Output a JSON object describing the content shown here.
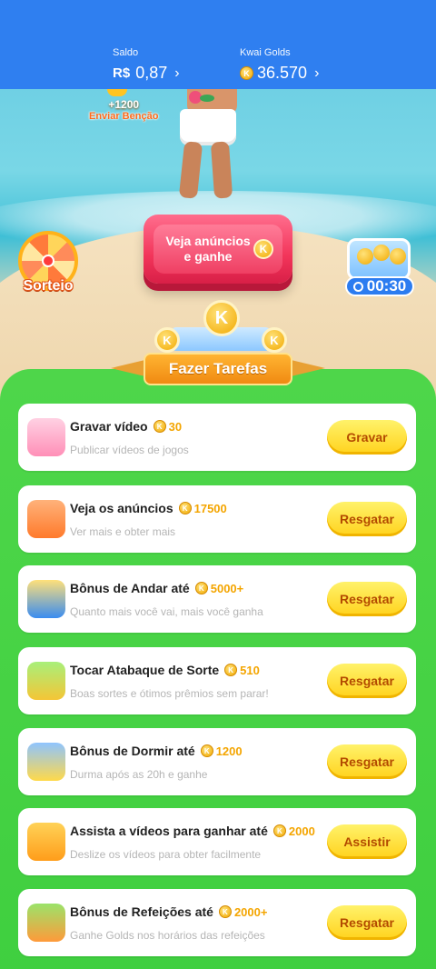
{
  "balance": {
    "saldo_label": "Saldo",
    "currency": "R$",
    "saldo_value": "0,87",
    "golds_label": "Kwai Golds",
    "golds_value": "36.570",
    "chevron": "›"
  },
  "scene": {
    "bencao_amount": "+1200",
    "bencao_label": "Enviar Benção",
    "ad_button_label": "Veja anúncios e ganhe",
    "sorteio_label": "Sorteio",
    "timer_value": "00:30",
    "coin_letter": "K"
  },
  "tasks_header": "Fazer Tarefas",
  "tasks": [
    {
      "title": "Gravar vídeo",
      "reward": "30",
      "subtitle": "Publicar vídeos de jogos",
      "button": "Gravar",
      "icon": "record-video-icon"
    },
    {
      "title": "Veja os anúncios",
      "reward": "17500",
      "subtitle": "Ver mais e obter mais",
      "button": "Resgatar",
      "icon": "tv-ad-icon"
    },
    {
      "title": "Bônus de Andar até",
      "reward": "5000+",
      "subtitle": "Quanto mais você vai, mais você ganha",
      "button": "Resgatar",
      "icon": "walking-boy-icon"
    },
    {
      "title": "Tocar Atabaque de Sorte",
      "reward": "510",
      "subtitle": "Boas sortes e ótimos prêmios sem parar!",
      "button": "Resgatar",
      "icon": "drum-icon"
    },
    {
      "title": "Bônus de Dormir até",
      "reward": "1200",
      "subtitle": "Durma após as 20h e ganhe",
      "button": "Resgatar",
      "icon": "moon-sleep-icon"
    },
    {
      "title": "Assista a vídeos para ganhar até",
      "reward": "2000",
      "subtitle": "Deslize os vídeos para obter facilmente",
      "button": "Assistir",
      "icon": "video-camera-icon"
    },
    {
      "title": "Bônus de Refeições até",
      "reward": "2000+",
      "subtitle": "Ganhe Golds nos horários das refeições",
      "button": "Resgatar",
      "icon": "meal-box-icon"
    }
  ],
  "colors": {
    "topbar": "#2f7ff0",
    "panel_green": "#3fcf3f",
    "button_yellow": "#ffd21c",
    "reward_gold": "#f4a500",
    "ad_button_red": "#f2355a"
  }
}
